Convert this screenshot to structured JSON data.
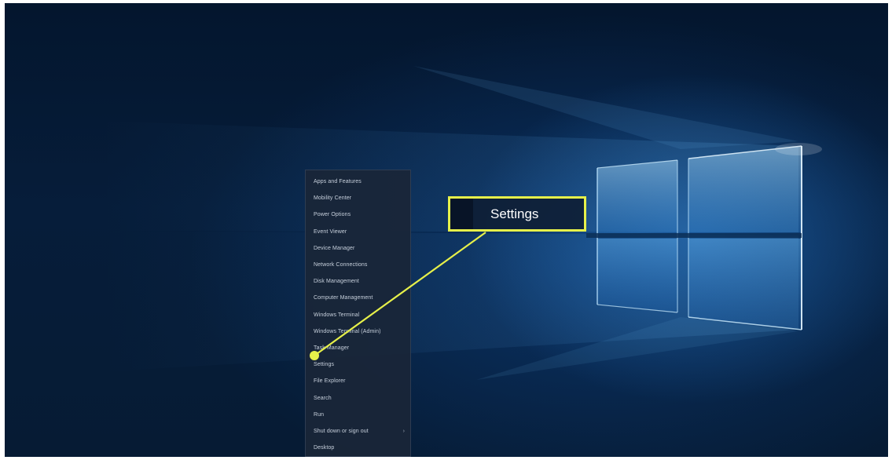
{
  "desktop": {
    "winx_menu": {
      "items": [
        {
          "label": "Apps and Features"
        },
        {
          "label": "Mobility Center"
        },
        {
          "label": "Power Options"
        },
        {
          "label": "Event Viewer"
        },
        {
          "label": "Device Manager"
        },
        {
          "label": "Network Connections"
        },
        {
          "label": "Disk Management"
        },
        {
          "label": "Computer Management"
        },
        {
          "label": "Windows Terminal"
        },
        {
          "label": "Windows Terminal (Admin)"
        },
        {
          "label": "Task Manager"
        },
        {
          "label": "Settings"
        },
        {
          "label": "File Explorer"
        },
        {
          "label": "Search"
        },
        {
          "label": "Run"
        },
        {
          "label": "Shut down or sign out",
          "submenu_icon": "chevron-right-icon",
          "submenu_glyph": "›"
        },
        {
          "label": "Desktop"
        }
      ],
      "highlighted_item": "Settings"
    },
    "callout": {
      "label": "Settings",
      "color": "#e6f04a"
    }
  }
}
